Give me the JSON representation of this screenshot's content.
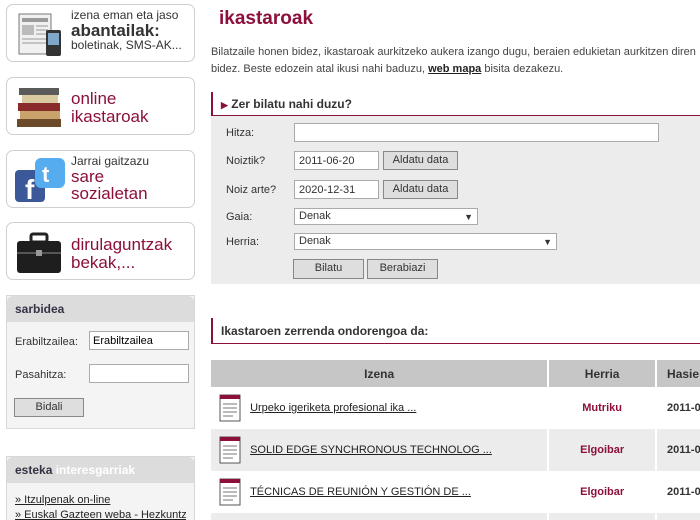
{
  "sidebar": {
    "banners": [
      {
        "line1": "izena eman eta jaso",
        "line2": "abantailak:",
        "line3": "boletinak, SMS-AK..."
      },
      {
        "line1": "online",
        "line2": "ikastaroak"
      },
      {
        "line1": "Jarrai gaitzazu",
        "line2": "sare",
        "line3": "sozialetan"
      },
      {
        "line1": "dirulaguntzak",
        "line2": "bekak,..."
      }
    ],
    "login": {
      "title": "sarbidea",
      "user_label": "Erabiltzailea:",
      "user_value": "Erabiltzailea",
      "pass_label": "Pasahitza:",
      "submit": "Bidali"
    },
    "links": {
      "title_dark": "esteka",
      "title_light": "interesgarriak",
      "items": [
        "» Itzulpenak on-line",
        "» Euskal Gazteen weba - Hezkuntza"
      ]
    }
  },
  "main": {
    "title": "ikastaroak",
    "intro_1": "Bilatzaile honen bidez, ikastaroak aurkitzeko aukera izango dugu, beraien edukietan aurkitzen diren",
    "intro_2": "bidez. Beste edozein atal ikusi nahi baduzu,",
    "intro_link": "web mapa",
    "intro_3": "bisita dezakezu.",
    "search": {
      "heading": "Zer bilatu nahi duzu?",
      "hitza_label": "Hitza:",
      "hitza_value": "",
      "from_label": "Noiztik?",
      "from_value": "2011-06-20",
      "to_label": "Noiz arte?",
      "to_value": "2020-12-31",
      "change_date": "Aldatu data",
      "gaia_label": "Gaia:",
      "gaia_value": "Denak",
      "herria_label": "Herria:",
      "herria_value": "Denak",
      "search_btn": "Bilatu",
      "reset_btn": "Berabiazi"
    },
    "list_heading": "Ikastaroen zerrenda ondorengoa da:",
    "table": {
      "headers": [
        "Izena",
        "Herria",
        "Hasiera"
      ],
      "rows": [
        {
          "name": "Urpeko igeriketa profesional ika ...",
          "town": "Mutriku",
          "date": "2011-0"
        },
        {
          "name": "SOLID EDGE SYNCHRONOUS TECHNOLOG ...",
          "town": "Elgoibar",
          "date": "2011-0"
        },
        {
          "name": "TÉCNICAS DE REUNIÓN Y GESTIÓN DE ...",
          "town": "Elgoibar",
          "date": "2011-0"
        }
      ]
    }
  },
  "colors": {
    "accent": "#8c0f3c",
    "panel": "#ececec",
    "header": "#c6c6c6"
  }
}
